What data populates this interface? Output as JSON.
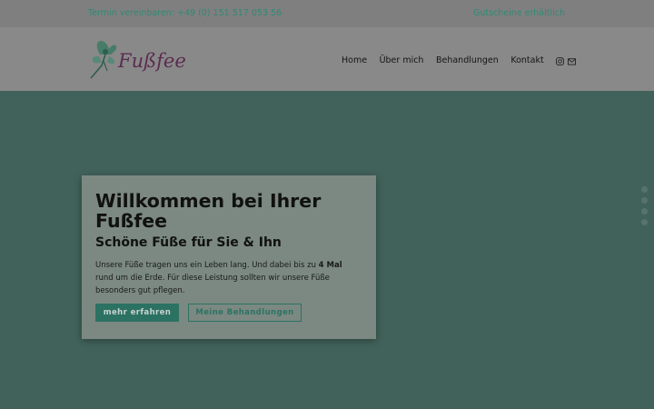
{
  "topbar": {
    "phone_text": "Termin vereinbaren: +49 (0) 151 517 053 56",
    "vouchers_text": "Gutscheine erhältlich"
  },
  "brand": {
    "logo_text": "Fußfee",
    "logo_color": "#5b2c4f"
  },
  "nav": {
    "items": [
      "Home",
      "Über mich",
      "Behandlungen",
      "Kontakt"
    ],
    "icons": [
      "instagram-icon",
      "mail-icon"
    ]
  },
  "hero": {
    "title": "Willkommen bei Ihrer Fußfee",
    "subtitle": "Schöne Füße für Sie & Ihn",
    "text_before": "Unsere Füße tragen uns ein Leben lang. Und dabei bis zu ",
    "text_bold": "4 Mal",
    "text_after": " rund um die Erde. Für diese Leistung sollten wir unsere Füße besonders gut pflegen.",
    "primary_button": "mehr erfahren",
    "secondary_button": "Meine Behandlungen"
  },
  "colors": {
    "accent": "#2c7263",
    "hero_background": "#41625a"
  }
}
